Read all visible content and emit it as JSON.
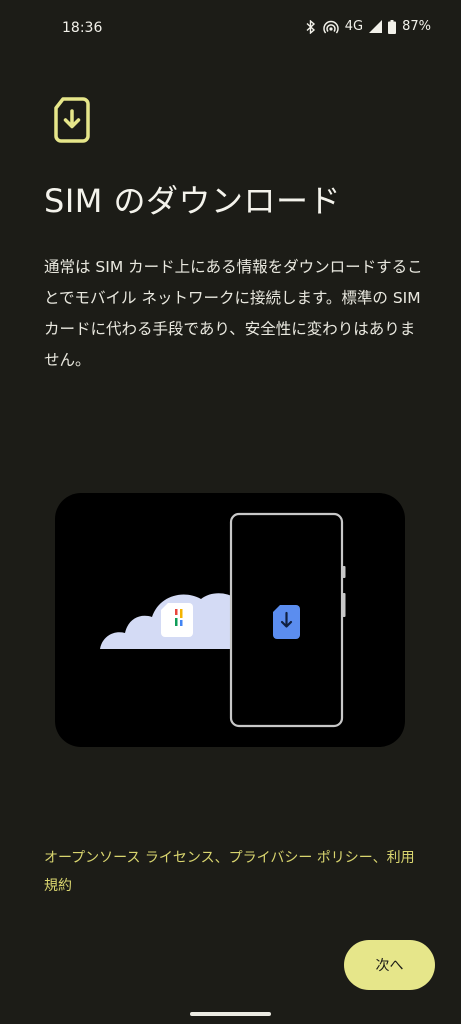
{
  "status_bar": {
    "time": "18:36",
    "network": "4G",
    "battery": "87%"
  },
  "icons": {
    "top": "sim-download-icon",
    "illustration_sim": "sim-download-icon",
    "bluetooth": "bluetooth-icon",
    "hotspot": "hotspot-icon",
    "signal": "signal-icon",
    "battery": "battery-icon"
  },
  "page": {
    "title": "SIM のダウンロード",
    "description": "通常は SIM カード上にある情報をダウンロードすることでモバイル ネットワークに接続します。標準の SIM カードに代わる手段であり、安全性に変わりはありません。"
  },
  "links": {
    "open_source": "オープンソース ライセンス",
    "separator1": "、",
    "privacy": "プライバシー ポリシー",
    "separator2": "、",
    "terms": "利用規約"
  },
  "buttons": {
    "next": "次へ"
  },
  "colors": {
    "background": "#1c1c17",
    "accent": "#e6e68a",
    "link": "#d9d56f",
    "sim_blue": "#5b8def"
  }
}
